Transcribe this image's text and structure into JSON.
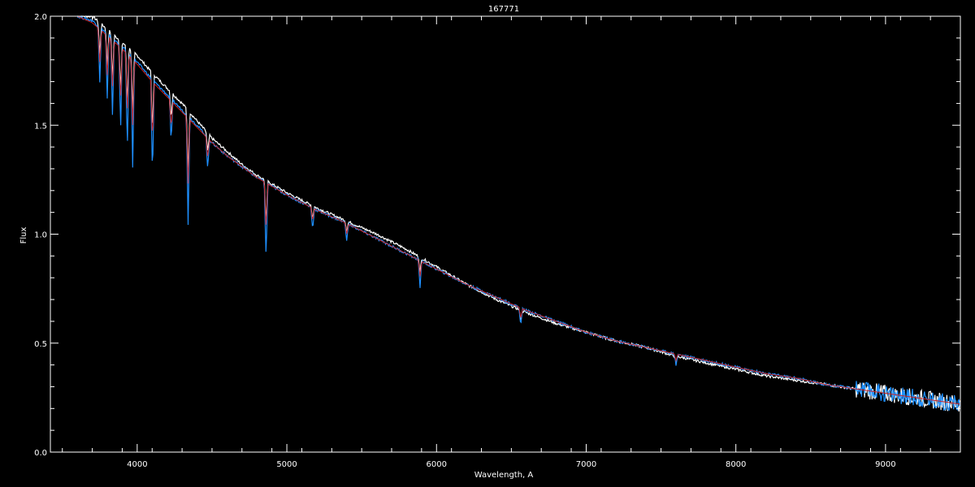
{
  "chart_data": {
    "type": "line",
    "title": "167771",
    "xlabel": "Wavelength, A",
    "ylabel": "Flux",
    "xlim": [
      3420,
      9500
    ],
    "ylim": [
      0.0,
      2.0
    ],
    "xticks": [
      4000,
      5000,
      6000,
      7000,
      8000,
      9000
    ],
    "xtick_labels": [
      "4000",
      "5000",
      "6000",
      "7000",
      "8000",
      "9000"
    ],
    "yticks": [
      0.0,
      0.5,
      1.0,
      1.5,
      2.0
    ],
    "ytick_labels": [
      "0.0",
      "0.5",
      "1.0",
      "1.5",
      "2.0"
    ],
    "grid": false,
    "background": "#000000",
    "series": [
      {
        "color": "#ffffff",
        "x": [
          3600,
          3700,
          3800,
          3900,
          4000,
          4100,
          4200,
          4300,
          4400,
          4500,
          4600,
          4700,
          4800,
          4900,
          5000,
          5200,
          5400,
          5600,
          5800,
          6000,
          6200,
          6400,
          6600,
          6800,
          7000,
          7200,
          7400,
          7600,
          7800,
          8000,
          8200,
          8400,
          8600,
          8800,
          9000,
          9200,
          9400,
          9500
        ],
        "y": [
          2.0,
          2.0,
          1.94,
          1.88,
          1.82,
          1.74,
          1.67,
          1.6,
          1.52,
          1.44,
          1.38,
          1.32,
          1.27,
          1.23,
          1.19,
          1.12,
          1.06,
          1.0,
          0.93,
          0.85,
          0.77,
          0.7,
          0.64,
          0.59,
          0.55,
          0.51,
          0.48,
          0.44,
          0.41,
          0.38,
          0.35,
          0.33,
          0.31,
          0.29,
          0.27,
          0.25,
          0.23,
          0.22
        ]
      },
      {
        "color": "#1e90ff",
        "x": [
          3600,
          3700,
          3800,
          3900,
          4000,
          4100,
          4200,
          4300,
          4400,
          4500,
          4600,
          4700,
          4800,
          4900,
          5000,
          5200,
          5400,
          5600,
          5800,
          6000,
          6200,
          6400,
          6600,
          6800,
          7000,
          7200,
          7400,
          7600,
          7800,
          8000,
          8200,
          8400,
          8600,
          8800,
          9000,
          9200,
          9400,
          9500
        ],
        "y": [
          2.0,
          1.98,
          1.92,
          1.86,
          1.79,
          1.71,
          1.64,
          1.57,
          1.5,
          1.42,
          1.36,
          1.31,
          1.26,
          1.22,
          1.18,
          1.11,
          1.05,
          0.98,
          0.91,
          0.84,
          0.77,
          0.71,
          0.65,
          0.6,
          0.55,
          0.51,
          0.48,
          0.45,
          0.42,
          0.39,
          0.36,
          0.34,
          0.31,
          0.29,
          0.27,
          0.25,
          0.23,
          0.22
        ]
      },
      {
        "color": "#cc2222",
        "x": [
          3600,
          3700,
          3800,
          3900,
          4000,
          4100,
          4200,
          4300,
          4400,
          4500,
          4600,
          4700,
          4800,
          4900,
          5000,
          5200,
          5400,
          5600,
          5800,
          6000,
          6200,
          6400,
          6600,
          6800,
          7000,
          7200,
          7400,
          7600,
          7800,
          8000,
          8200,
          8400,
          8600,
          8800,
          9000,
          9200,
          9400,
          9500
        ],
        "y": [
          2.0,
          1.97,
          1.91,
          1.85,
          1.78,
          1.7,
          1.63,
          1.56,
          1.49,
          1.42,
          1.36,
          1.31,
          1.26,
          1.22,
          1.18,
          1.11,
          1.05,
          0.98,
          0.91,
          0.84,
          0.77,
          0.71,
          0.65,
          0.6,
          0.55,
          0.51,
          0.48,
          0.45,
          0.42,
          0.39,
          0.36,
          0.34,
          0.31,
          0.29,
          0.27,
          0.25,
          0.23,
          0.22
        ]
      }
    ],
    "absorption_lines": [
      {
        "x": 3750,
        "depth": 0.25
      },
      {
        "x": 3800,
        "depth": 0.3
      },
      {
        "x": 3835,
        "depth": 0.35
      },
      {
        "x": 3889,
        "depth": 0.4
      },
      {
        "x": 3934,
        "depth": 0.45
      },
      {
        "x": 3970,
        "depth": 0.5
      },
      {
        "x": 4102,
        "depth": 0.45
      },
      {
        "x": 4227,
        "depth": 0.2
      },
      {
        "x": 4340,
        "depth": 0.5
      },
      {
        "x": 4471,
        "depth": 0.15
      },
      {
        "x": 4861,
        "depth": 0.35
      },
      {
        "x": 5172,
        "depth": 0.1
      },
      {
        "x": 5400,
        "depth": 0.08
      },
      {
        "x": 5890,
        "depth": 0.12
      },
      {
        "x": 6563,
        "depth": 0.08
      },
      {
        "x": 7600,
        "depth": 0.05
      }
    ]
  }
}
